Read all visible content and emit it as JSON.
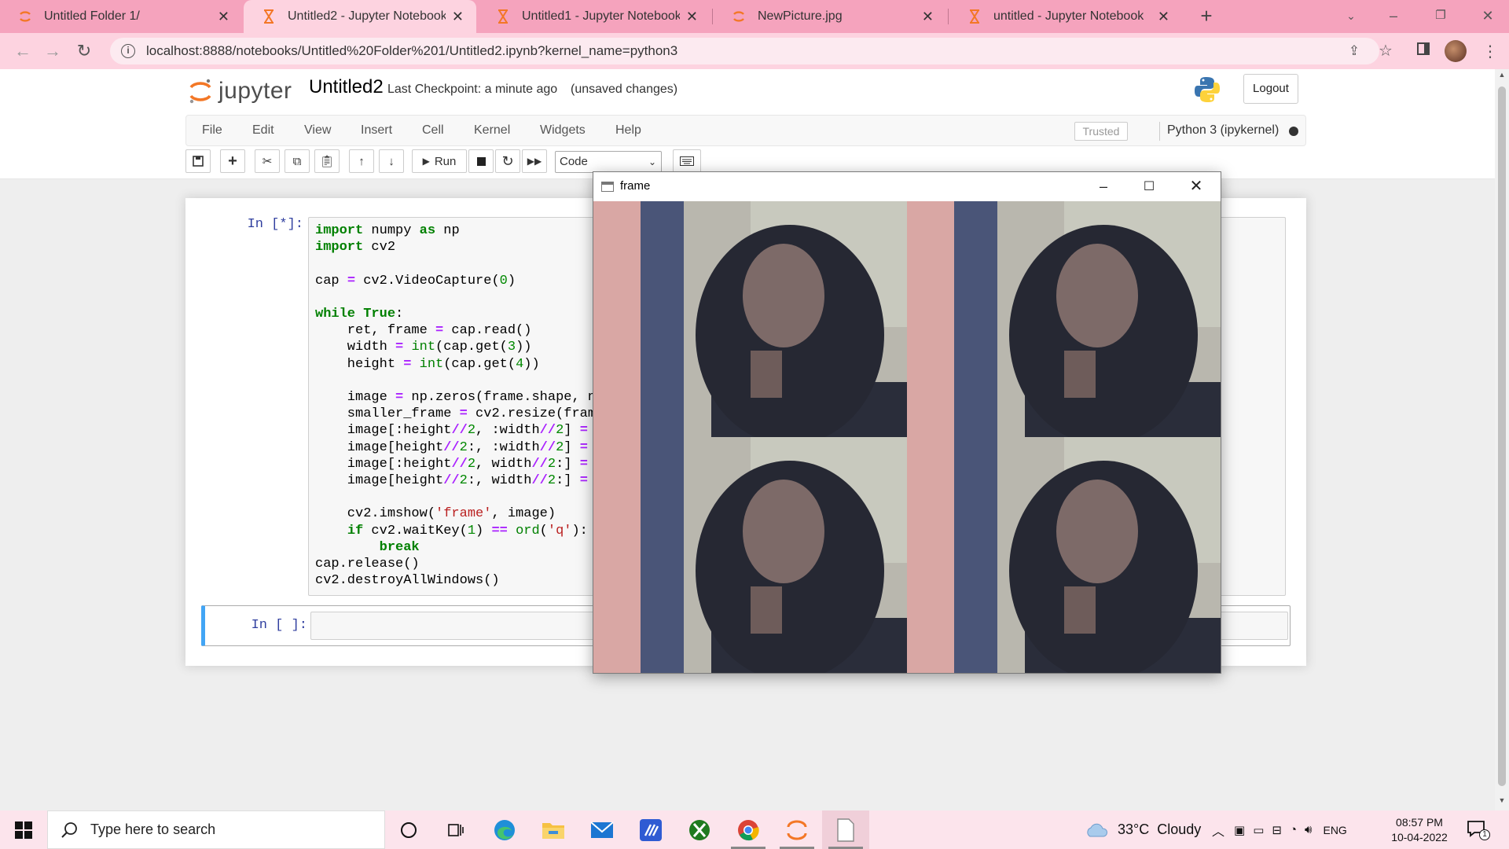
{
  "browser": {
    "tabs": [
      {
        "title": "Untitled Folder 1/",
        "icon": "jupyter-spinner-icon",
        "active": false
      },
      {
        "title": "Untitled2 - Jupyter Notebook",
        "icon": "hourglass-icon",
        "active": true
      },
      {
        "title": "Untitled1 - Jupyter Notebook",
        "icon": "hourglass-icon",
        "active": false
      },
      {
        "title": "NewPicture.jpg",
        "icon": "jupyter-spinner-icon",
        "active": false
      },
      {
        "title": "untitled - Jupyter Notebook",
        "icon": "hourglass-icon",
        "active": false
      }
    ],
    "new_tab_label": "+",
    "url": "localhost:8888/notebooks/Untitled%20Folder%201/Untitled2.ipynb?kernel_name=python3"
  },
  "jupyter": {
    "logo_text": "jupyter",
    "notebook_name": "Untitled2",
    "checkpoint": "Last Checkpoint: a minute ago",
    "unsaved": "(unsaved changes)",
    "logout_label": "Logout",
    "menu": [
      "File",
      "Edit",
      "View",
      "Insert",
      "Cell",
      "Kernel",
      "Widgets",
      "Help"
    ],
    "trusted_label": "Trusted",
    "kernel_name": "Python 3 (ipykernel)",
    "toolbar": {
      "run_label": "Run",
      "cell_type": "Code"
    },
    "cells": [
      {
        "prompt": "In [*]:"
      },
      {
        "prompt": "In [ ]:"
      }
    ]
  },
  "cv_window": {
    "title": "frame"
  },
  "taskbar": {
    "search_placeholder": "Type here to search",
    "weather": "33°C  Cloudy",
    "language": "ENG",
    "time": "08:57 PM",
    "date": "10-04-2022",
    "notification_count": "1"
  },
  "colors": {
    "tab_strip": "#f5a3bd",
    "active_tab": "#fdd3e0",
    "jupyter_orange": "#f37726",
    "prompt_blue": "#303f9f",
    "selected_cell_border": "#42a5f5"
  }
}
